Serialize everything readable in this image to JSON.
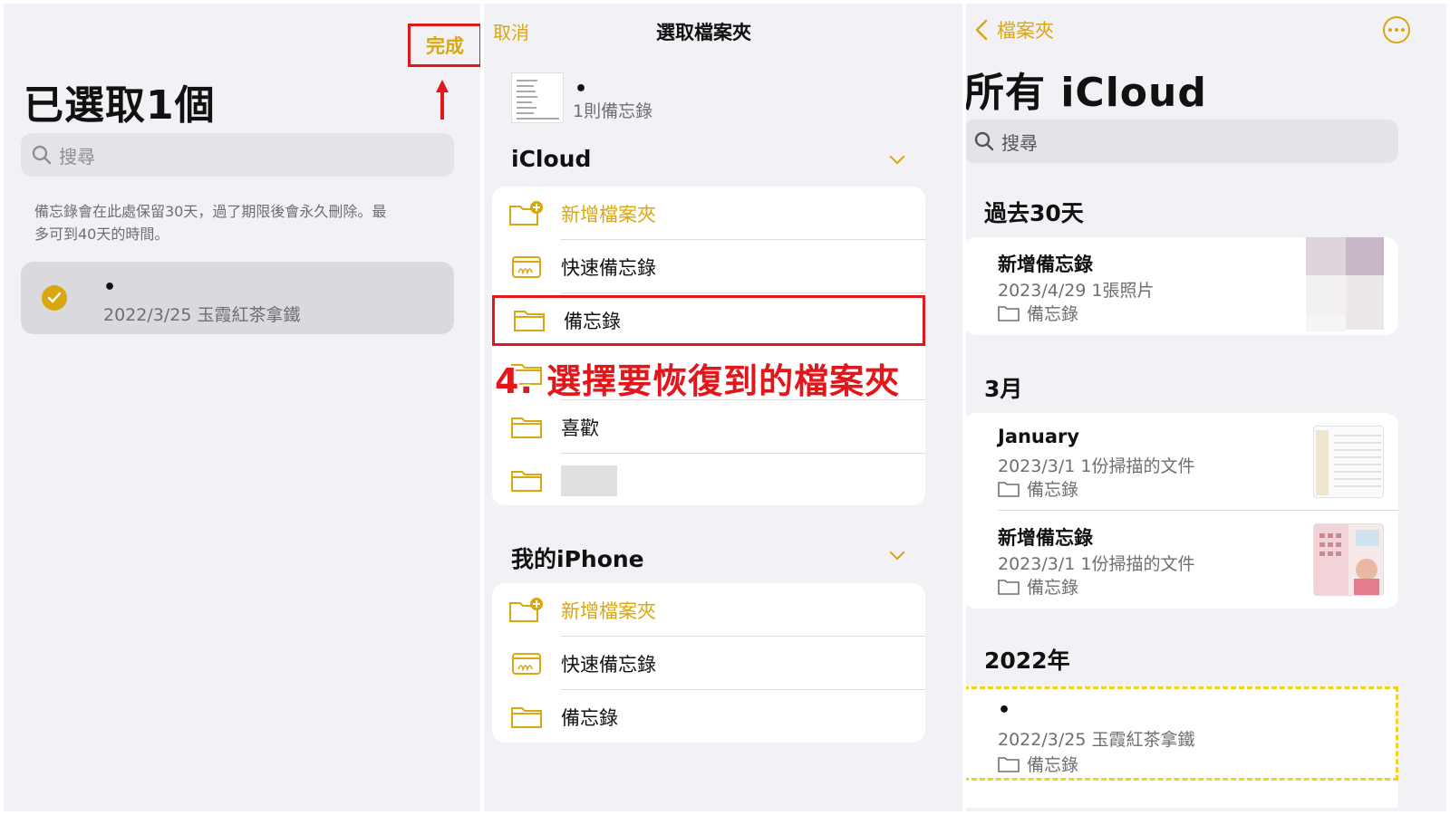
{
  "colors": {
    "accent": "#d9a70f",
    "annotation_red": "#e2171b",
    "highlight_yellow": "#f2d21d"
  },
  "panel1": {
    "done_label": "完成",
    "title": "已選取1個",
    "search_placeholder": "搜尋",
    "hint_line1": "備忘錄會在此處保留30天，過了期限後會永久刪除。最",
    "hint_line2": "多可到40天的時間。",
    "selected_note": {
      "title": "•",
      "meta": "2022/3/25  玉霞紅茶拿鐵"
    }
  },
  "panel2": {
    "cancel_label": "取消",
    "nav_title": "選取檔案夾",
    "preview": {
      "title": "•",
      "subtitle": "1則備忘錄"
    },
    "icloud_section": {
      "title": "iCloud",
      "rows": [
        {
          "label": "新增檔案夾",
          "icon": "folder-add-icon"
        },
        {
          "label": "快速備忘錄",
          "icon": "quick-note-icon"
        },
        {
          "label": "備忘錄",
          "icon": "folder-icon"
        },
        {
          "label": "",
          "icon": "folder-icon"
        },
        {
          "label": "喜歡",
          "icon": "folder-icon"
        },
        {
          "label": "",
          "icon": "folder-icon"
        }
      ]
    },
    "annotation": "4. 選擇要恢復到的檔案夾",
    "iphone_section": {
      "title": "我的iPhone",
      "rows": [
        {
          "label": "新增檔案夾",
          "icon": "folder-add-icon"
        },
        {
          "label": "快速備忘錄",
          "icon": "quick-note-icon"
        },
        {
          "label": "備忘錄",
          "icon": "folder-icon"
        }
      ]
    }
  },
  "panel3": {
    "back_label": "檔案夾",
    "title": "所有 iCloud",
    "search_placeholder": "搜尋",
    "groups": [
      {
        "heading": "過去30天",
        "notes": [
          {
            "title": "新增備忘錄",
            "meta": "2023/4/29  1張照片",
            "folder": "備忘錄"
          }
        ]
      },
      {
        "heading": "3月",
        "notes": [
          {
            "title": "January",
            "meta": "2023/3/1  1份掃描的文件",
            "folder": "備忘錄"
          },
          {
            "title": "新增備忘錄",
            "meta": "2023/3/1  1份掃描的文件",
            "folder": "備忘錄"
          }
        ]
      },
      {
        "heading": "2022年",
        "notes": [
          {
            "title": "•",
            "meta": "2022/3/25  玉霞紅茶拿鐵",
            "folder": "備忘錄"
          }
        ]
      }
    ]
  }
}
